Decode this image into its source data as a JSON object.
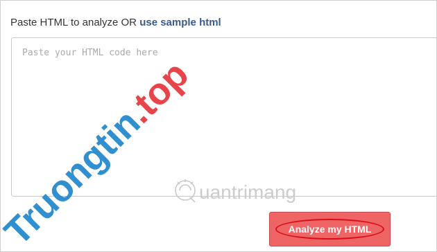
{
  "prompt": {
    "text": "Paste HTML to analyze OR ",
    "sample_link": "use sample html"
  },
  "editor": {
    "placeholder": "Paste your HTML code here",
    "value": ""
  },
  "analyze_button": {
    "label": "Analyze my HTML"
  },
  "watermarks": {
    "site": "Truongtin.top",
    "brand": "uantrimang"
  },
  "colors": {
    "link": "#3a5a8c",
    "button": "#ef6464",
    "highlight_ring": "#d70f17",
    "watermark_blue": "#2f8fcf",
    "watermark_red": "#e8454a"
  }
}
